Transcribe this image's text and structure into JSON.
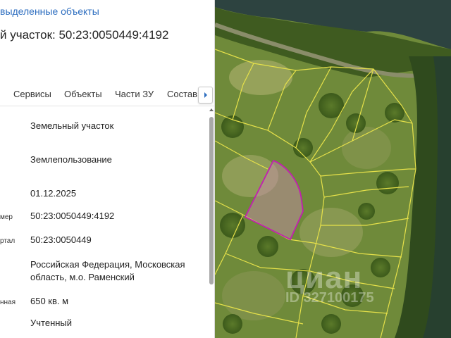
{
  "panel": {
    "back_link": "выделенные объекты",
    "title": "й участок: 50:23:0050449:4192",
    "tabs": [
      "Сервисы",
      "Объекты",
      "Части ЗУ",
      "Состав"
    ],
    "rows": [
      {
        "label": "",
        "value": "Земельный участок"
      },
      {
        "label": "",
        "value": "Землепользование"
      },
      {
        "label": "",
        "value": "01.12.2025"
      },
      {
        "label": "мер",
        "value": "50:23:0050449:4192"
      },
      {
        "label": "ртал",
        "value": "50:23:0050449"
      },
      {
        "label": "",
        "value": "Российская Федерация, Московская область, м.о. Раменский"
      },
      {
        "label": "нная",
        "value": "650 кв. м"
      },
      {
        "label": "",
        "value": "Учтенный"
      }
    ]
  },
  "map": {
    "parcel_boundary_color": "#e6e14a",
    "selected_parcel_color": "#c21fb0"
  },
  "watermark": {
    "brand": "циан",
    "id": "ID 327100175"
  }
}
